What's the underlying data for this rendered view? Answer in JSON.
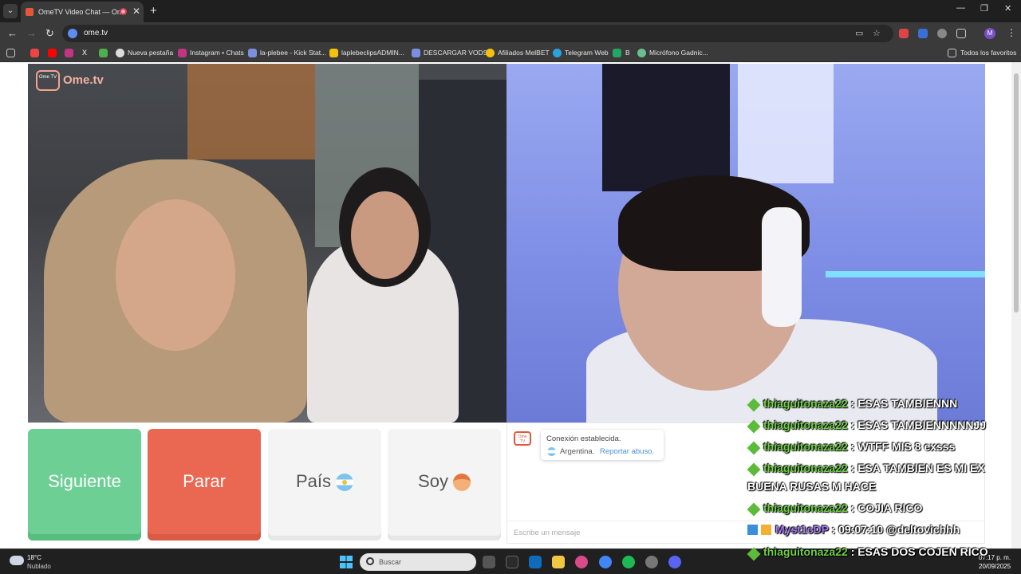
{
  "browser": {
    "tab_title": "OmeTV Video Chat — Ome",
    "url": "ome.tv",
    "window_controls": [
      "—",
      "❐",
      "✕"
    ],
    "bookmarks": [
      {
        "label": "Nueva pestaña",
        "icon": "globe-icon"
      },
      {
        "label": "Instagram • Chats",
        "icon": "instagram-icon"
      },
      {
        "label": "la-plebee - Kick Stat...",
        "icon": "kick-icon"
      },
      {
        "label": "laplebeclipsADMIN...",
        "icon": "drive-icon"
      },
      {
        "label": "DESCARGAR VODS",
        "icon": "kick-icon"
      },
      {
        "label": "Afiliados MelBET",
        "icon": "melbet-icon"
      },
      {
        "label": "Telegram Web",
        "icon": "telegram-icon"
      },
      {
        "label": "B",
        "icon": "sheets-icon"
      },
      {
        "label": "Micrófono Gadnic...",
        "icon": "gadnic-icon"
      }
    ],
    "all_bookmarks": "Todos los favoritos"
  },
  "ometv": {
    "logo_text": "Ome.tv",
    "logo_badge": "Ome TV",
    "buttons": {
      "next": "Siguiente",
      "stop": "Parar",
      "country": "País",
      "gender": "Soy"
    },
    "chat": {
      "system_line1": "Conexión establecida.",
      "country": "Argentina.",
      "report": "Reportar abuso.",
      "input_placeholder": "Escribe un mensaje"
    }
  },
  "stream_chat": [
    {
      "user": "thiaguitonaza22",
      "text": ": ESAS TAMBIENNN"
    },
    {
      "user": "thiaguitonaza22",
      "text": ": ESAS TAMBIENNNNNJJ"
    },
    {
      "user": "thiaguitonaza22",
      "text": ": WTFF MIS 8 exsss"
    },
    {
      "user": "thiaguitonaza22",
      "text": ": ESA TAMBIEN ES MI EX"
    },
    {
      "user": "",
      "text": "BUENA RUSAS M HACE"
    },
    {
      "user": "thiaguitonaza22",
      "text": ": COJIA RICO"
    },
    {
      "user": "Myst1cDP",
      "text": ": 09:07:10 @deltovichhh"
    },
    {
      "user": "thiaguitonaza22",
      "text": ": ESAS DOS COJEN RICO"
    }
  ],
  "taskbar": {
    "temp": "18°C",
    "weather": "Nublado",
    "search_label": "Buscar",
    "time": "07:17 p. m.",
    "date": "20/09/2025"
  },
  "colors": {
    "next": "#6ecf95",
    "stop": "#ea6852",
    "brand": "#e4573d",
    "chat_user": "#6fcf46"
  }
}
